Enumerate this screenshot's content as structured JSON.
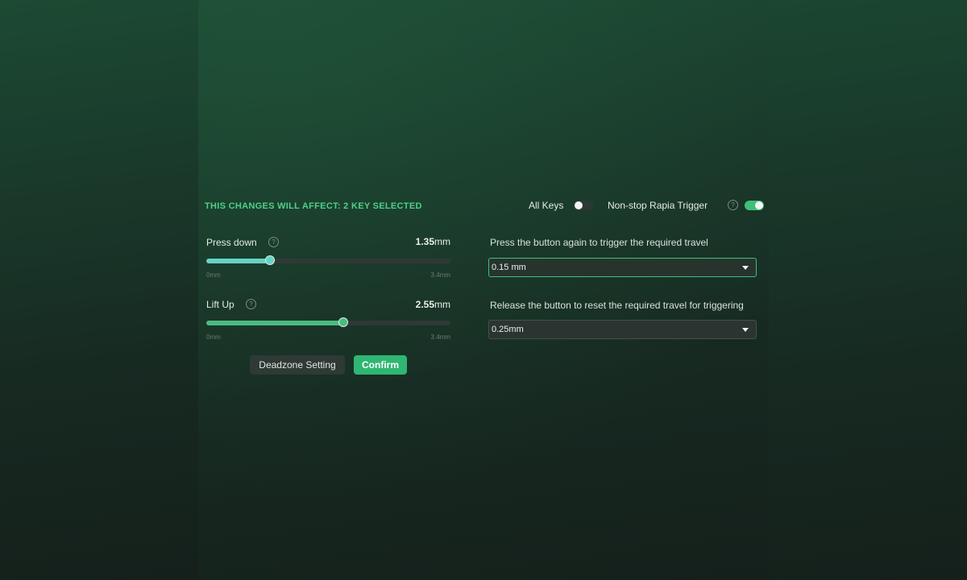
{
  "header": {
    "affect_label": "THIS CHANGES WILL AFFECT: 2 KEY SELECTED",
    "all_keys_label": "All Keys",
    "all_keys_on": false,
    "rapid_trigger_label": "Non-stop Rapia Trigger",
    "rapid_trigger_on": true,
    "help_glyph": "?"
  },
  "press_down": {
    "label": "Press down",
    "value_number": "1.35",
    "unit": "mm",
    "min_label": "0mm",
    "max_label": "3.4mm",
    "fraction": 0.26,
    "fill_color": "#67d3c6"
  },
  "lift_up": {
    "label": "Lift Up",
    "value_number": "2.55",
    "unit": "mm",
    "min_label": "0mm",
    "max_label": "3.4mm",
    "fraction": 0.56,
    "fill_color": "#4cbb82"
  },
  "buttons": {
    "deadzone_label": "Deadzone Setting",
    "confirm_label": "Confirm"
  },
  "press_again": {
    "label": "Press the button again to trigger the required travel",
    "value": "0.15 mm"
  },
  "release": {
    "label": "Release the button to reset the required travel for triggering",
    "value": "0.25mm"
  },
  "colors": {
    "accent": "#3fc07a",
    "heading": "#4fd08a"
  },
  "icons": [
    "help-icon",
    "chevron-down-icon"
  ]
}
